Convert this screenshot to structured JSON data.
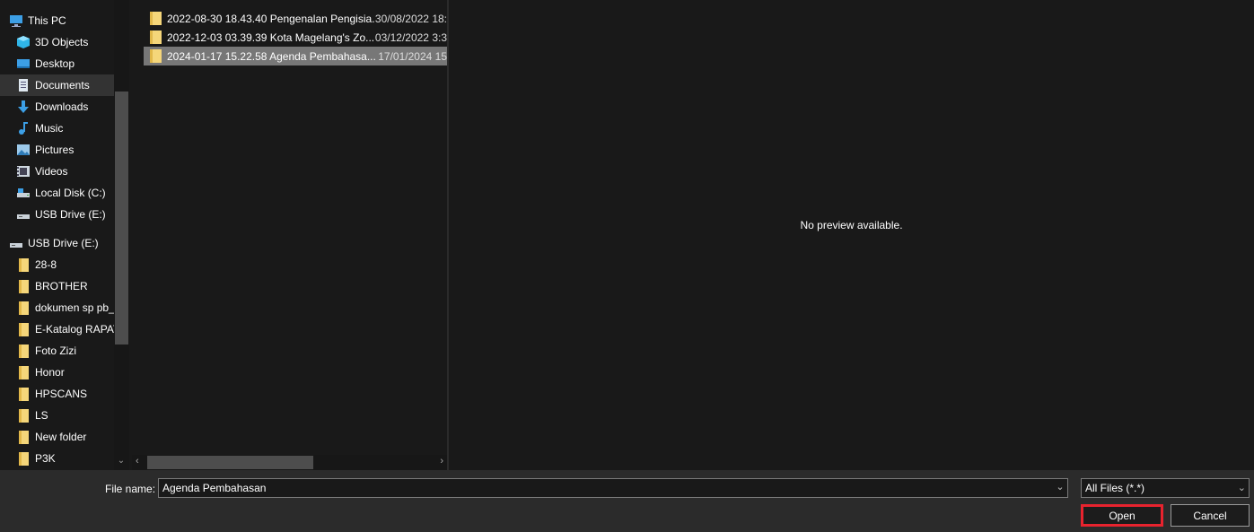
{
  "nav": {
    "items": [
      {
        "label": "This PC",
        "icon": "pc-icon"
      },
      {
        "label": "3D Objects",
        "icon": "3d-objects-icon"
      },
      {
        "label": "Desktop",
        "icon": "desktop-icon"
      },
      {
        "label": "Documents",
        "icon": "documents-icon",
        "selected": true
      },
      {
        "label": "Downloads",
        "icon": "download-arrow-icon"
      },
      {
        "label": "Music",
        "icon": "music-note-icon"
      },
      {
        "label": "Pictures",
        "icon": "pictures-icon"
      },
      {
        "label": "Videos",
        "icon": "videos-icon"
      },
      {
        "label": "Local Disk (C:)",
        "icon": "local-disk-icon"
      },
      {
        "label": "USB Drive (E:)",
        "icon": "usb-drive-icon"
      },
      {
        "label": "USB Drive (E:)",
        "icon": "usb-drive-icon"
      },
      {
        "label": "28-8",
        "icon": "folder-icon"
      },
      {
        "label": "BROTHER",
        "icon": "folder-icon"
      },
      {
        "label": "dokumen sp pb_",
        "icon": "folder-icon"
      },
      {
        "label": "E-Katalog RAPAT",
        "icon": "folder-icon"
      },
      {
        "label": "Foto Zizi",
        "icon": "folder-icon"
      },
      {
        "label": "Honor",
        "icon": "folder-icon"
      },
      {
        "label": "HPSCANS",
        "icon": "folder-icon"
      },
      {
        "label": "LS",
        "icon": "folder-icon"
      },
      {
        "label": "New folder",
        "icon": "folder-icon"
      },
      {
        "label": "P3K",
        "icon": "folder-icon"
      }
    ]
  },
  "files": [
    {
      "name": "2022-08-30 18.43.40 Pengenalan Pengisia...",
      "date": "30/08/2022 18:"
    },
    {
      "name": "2022-12-03 03.39.39 Kota Magelang's Zo...",
      "date": "03/12/2022 3:3"
    },
    {
      "name": "2024-01-17 15.22.58 Agenda Pembahasa...",
      "date": "17/01/2024 15",
      "selected": true
    }
  ],
  "preview": {
    "message": "No preview available."
  },
  "bottom": {
    "file_name_label": "File name:",
    "file_name_value": "Agenda Pembahasan",
    "file_type": "All Files (*.*)",
    "open_label": "Open",
    "cancel_label": "Cancel"
  },
  "colors": {
    "folder": "#f5d67a",
    "accent_blue": "#3c9fe6",
    "open_outline": "#e8232e",
    "selected_row": "#777777"
  }
}
